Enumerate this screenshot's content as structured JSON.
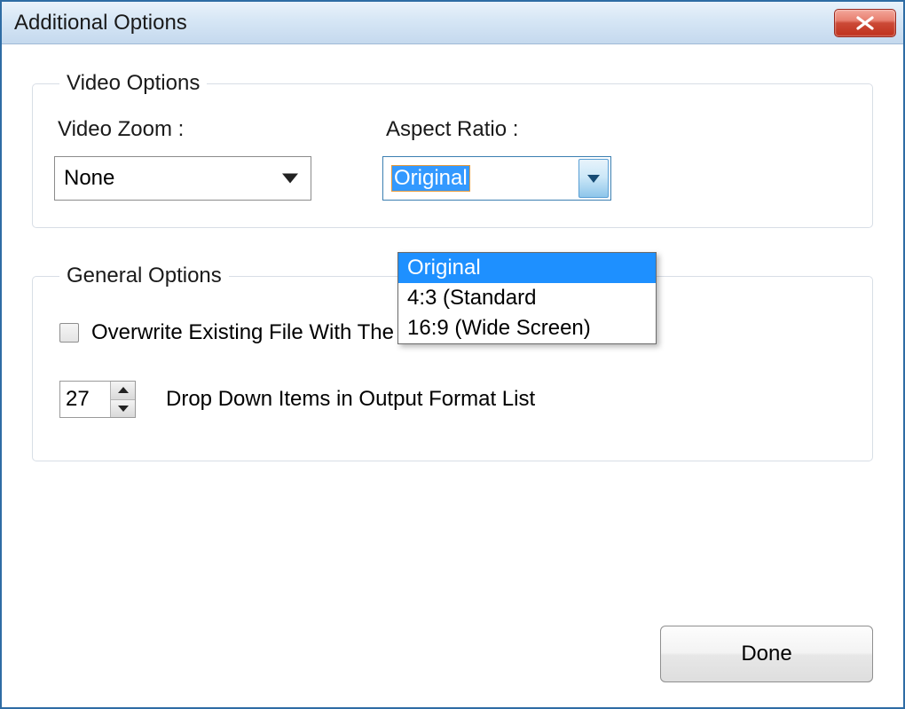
{
  "window": {
    "title": "Additional Options"
  },
  "video_options": {
    "legend": "Video Options",
    "zoom_label": "Video Zoom :",
    "zoom_value": "None",
    "aspect_label": "Aspect Ratio :",
    "aspect_value": "Original",
    "aspect_options": {
      "0": "Original",
      "1": "4:3 (Standard",
      "2": "16:9 (Wide Screen)"
    }
  },
  "general_options": {
    "legend": "General Options",
    "overwrite_label": "Overwrite Existing File With The Same Name",
    "overwrite_checked": false,
    "dropdown_count": "27",
    "dropdown_count_label": "Drop Down Items in Output Format List"
  },
  "footer": {
    "done_label": "Done"
  },
  "icons": {
    "close": "close-icon"
  }
}
